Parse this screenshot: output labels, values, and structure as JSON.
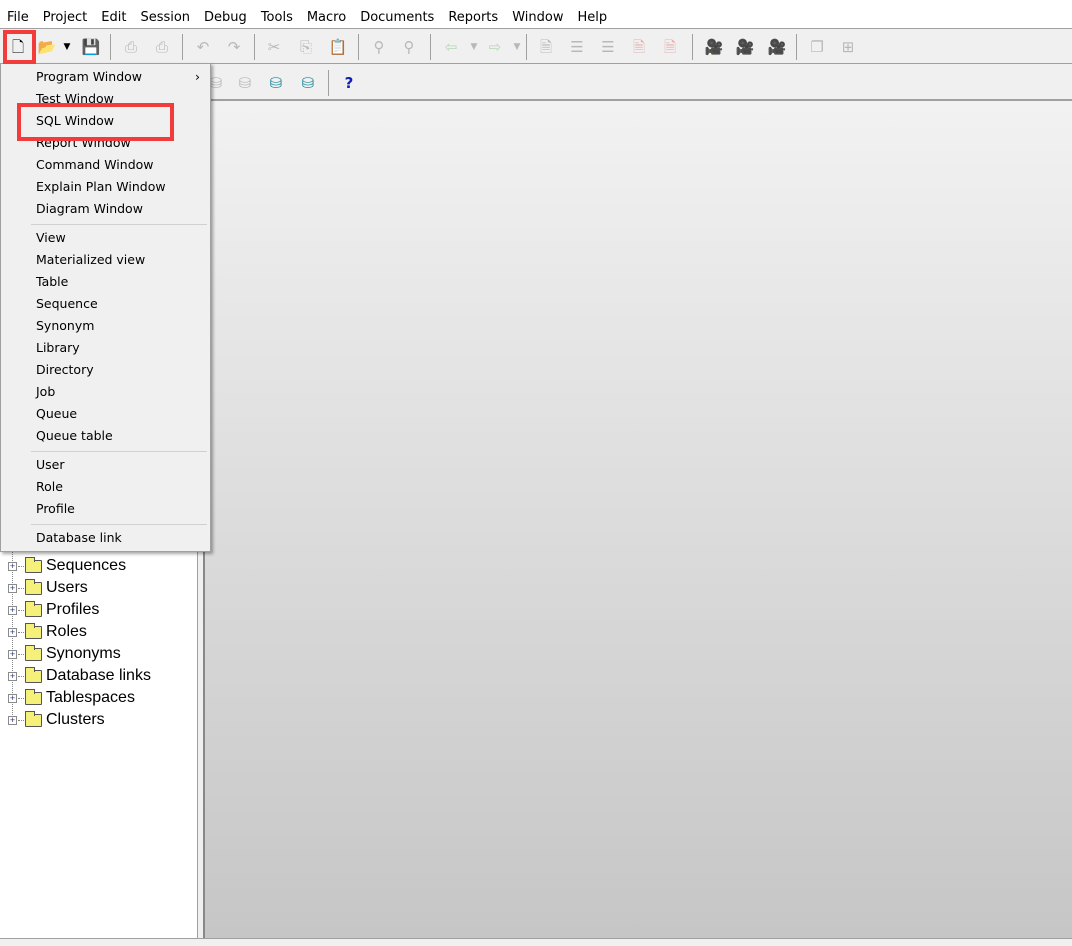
{
  "menubar": [
    "File",
    "Project",
    "Edit",
    "Session",
    "Debug",
    "Tools",
    "Macro",
    "Documents",
    "Reports",
    "Window",
    "Help"
  ],
  "toolbar1": [
    "new-icon",
    "open-icon",
    "open-dropdown-icon",
    "save-icon",
    "print-icon",
    "print-setup-icon",
    "undo-icon",
    "redo-icon",
    "cut-icon",
    "copy-icon",
    "paste-icon",
    "find-icon",
    "find-next-icon",
    "indent-back-icon",
    "dropdown-icon",
    "indent-forward-icon",
    "dropdown-icon",
    "verify-icon",
    "indent-icon",
    "unindent-icon",
    "uppercase-icon",
    "lowercase-icon",
    "record-macro-icon",
    "play-macro-icon",
    "macro-library-icon",
    "cascade-icon",
    "tile-icon"
  ],
  "toolbar2": {
    "help_label": "?"
  },
  "new_menu": {
    "groups": [
      [
        "Program Window",
        "Test Window",
        "SQL Window",
        "Report Window",
        "Command Window",
        "Explain Plan Window",
        "Diagram Window"
      ],
      [
        "View",
        "Materialized view",
        "Table",
        "Sequence",
        "Synonym",
        "Library",
        "Directory",
        "Job",
        "Queue",
        "Queue table"
      ],
      [
        "User",
        "Role",
        "Profile"
      ],
      [
        "Database link"
      ]
    ],
    "submenu_arrow": "›",
    "highlighted": "SQL Window"
  },
  "tree": [
    "Sequences",
    "Users",
    "Profiles",
    "Roles",
    "Synonyms",
    "Database links",
    "Tablespaces",
    "Clusters"
  ],
  "colors": {
    "highlight": "#f23b3b",
    "folder": "#f5f07a"
  }
}
